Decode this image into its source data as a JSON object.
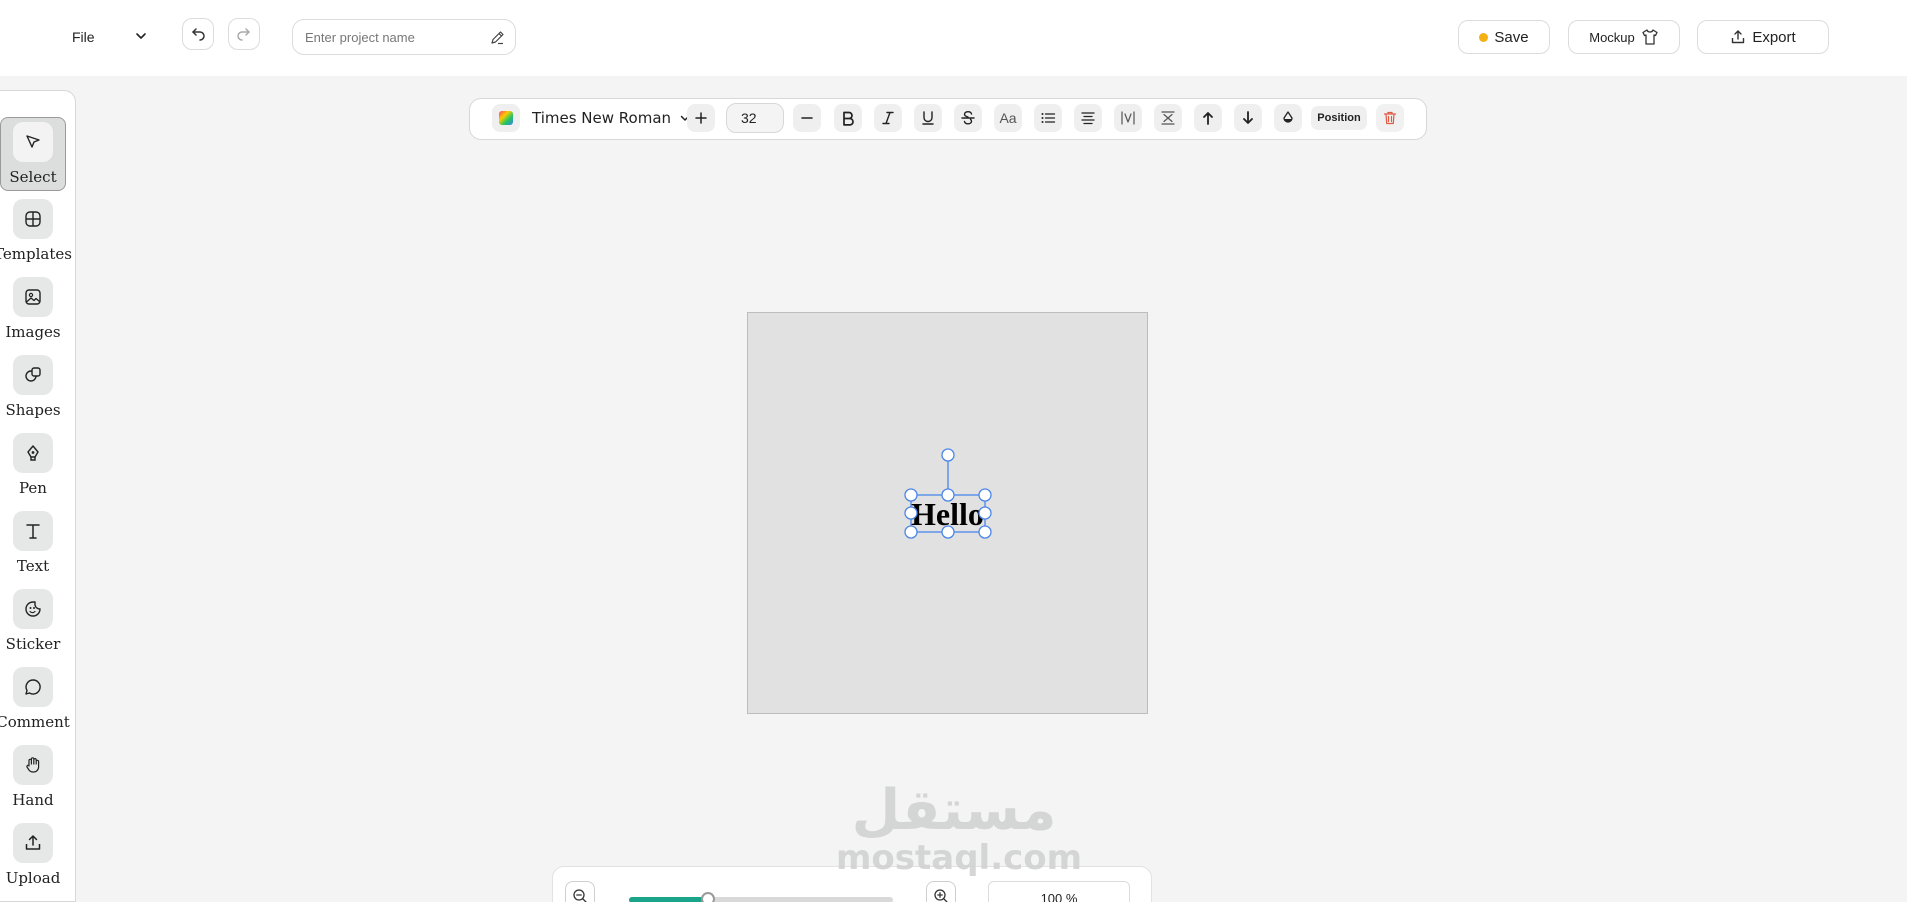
{
  "header": {
    "file_label": "File",
    "project_placeholder": "Enter project name",
    "save_label": "Save",
    "save_status_color": "#f5b014",
    "mockup_label": "Mockup",
    "export_label": "Export"
  },
  "sidebar": {
    "items": [
      {
        "label": "Select",
        "icon": "pointer-icon",
        "active": true
      },
      {
        "label": "Templates",
        "icon": "grid-icon"
      },
      {
        "label": "Images",
        "icon": "image-icon"
      },
      {
        "label": "Shapes",
        "icon": "shapes-icon"
      },
      {
        "label": "Pen",
        "icon": "pen-icon"
      },
      {
        "label": "Text",
        "icon": "text-icon"
      },
      {
        "label": "Sticker",
        "icon": "sticker-icon"
      },
      {
        "label": "Comment",
        "icon": "comment-icon"
      },
      {
        "label": "Hand",
        "icon": "hand-icon"
      },
      {
        "label": "Upload",
        "icon": "upload-icon"
      }
    ]
  },
  "toolbar": {
    "font_family": "Times New Roman",
    "font_size": "32",
    "position_label": "Position",
    "case_label": "Aa"
  },
  "canvas": {
    "text": "Hello",
    "background": "#e1e1e1",
    "selection_color": "#4a86e8"
  },
  "watermark": {
    "arabic": "مستقل",
    "latin": "mostaql.com"
  },
  "zoom": {
    "value_label": "100 %",
    "slider_fraction": 0.3,
    "accent": "#1aa58a"
  }
}
